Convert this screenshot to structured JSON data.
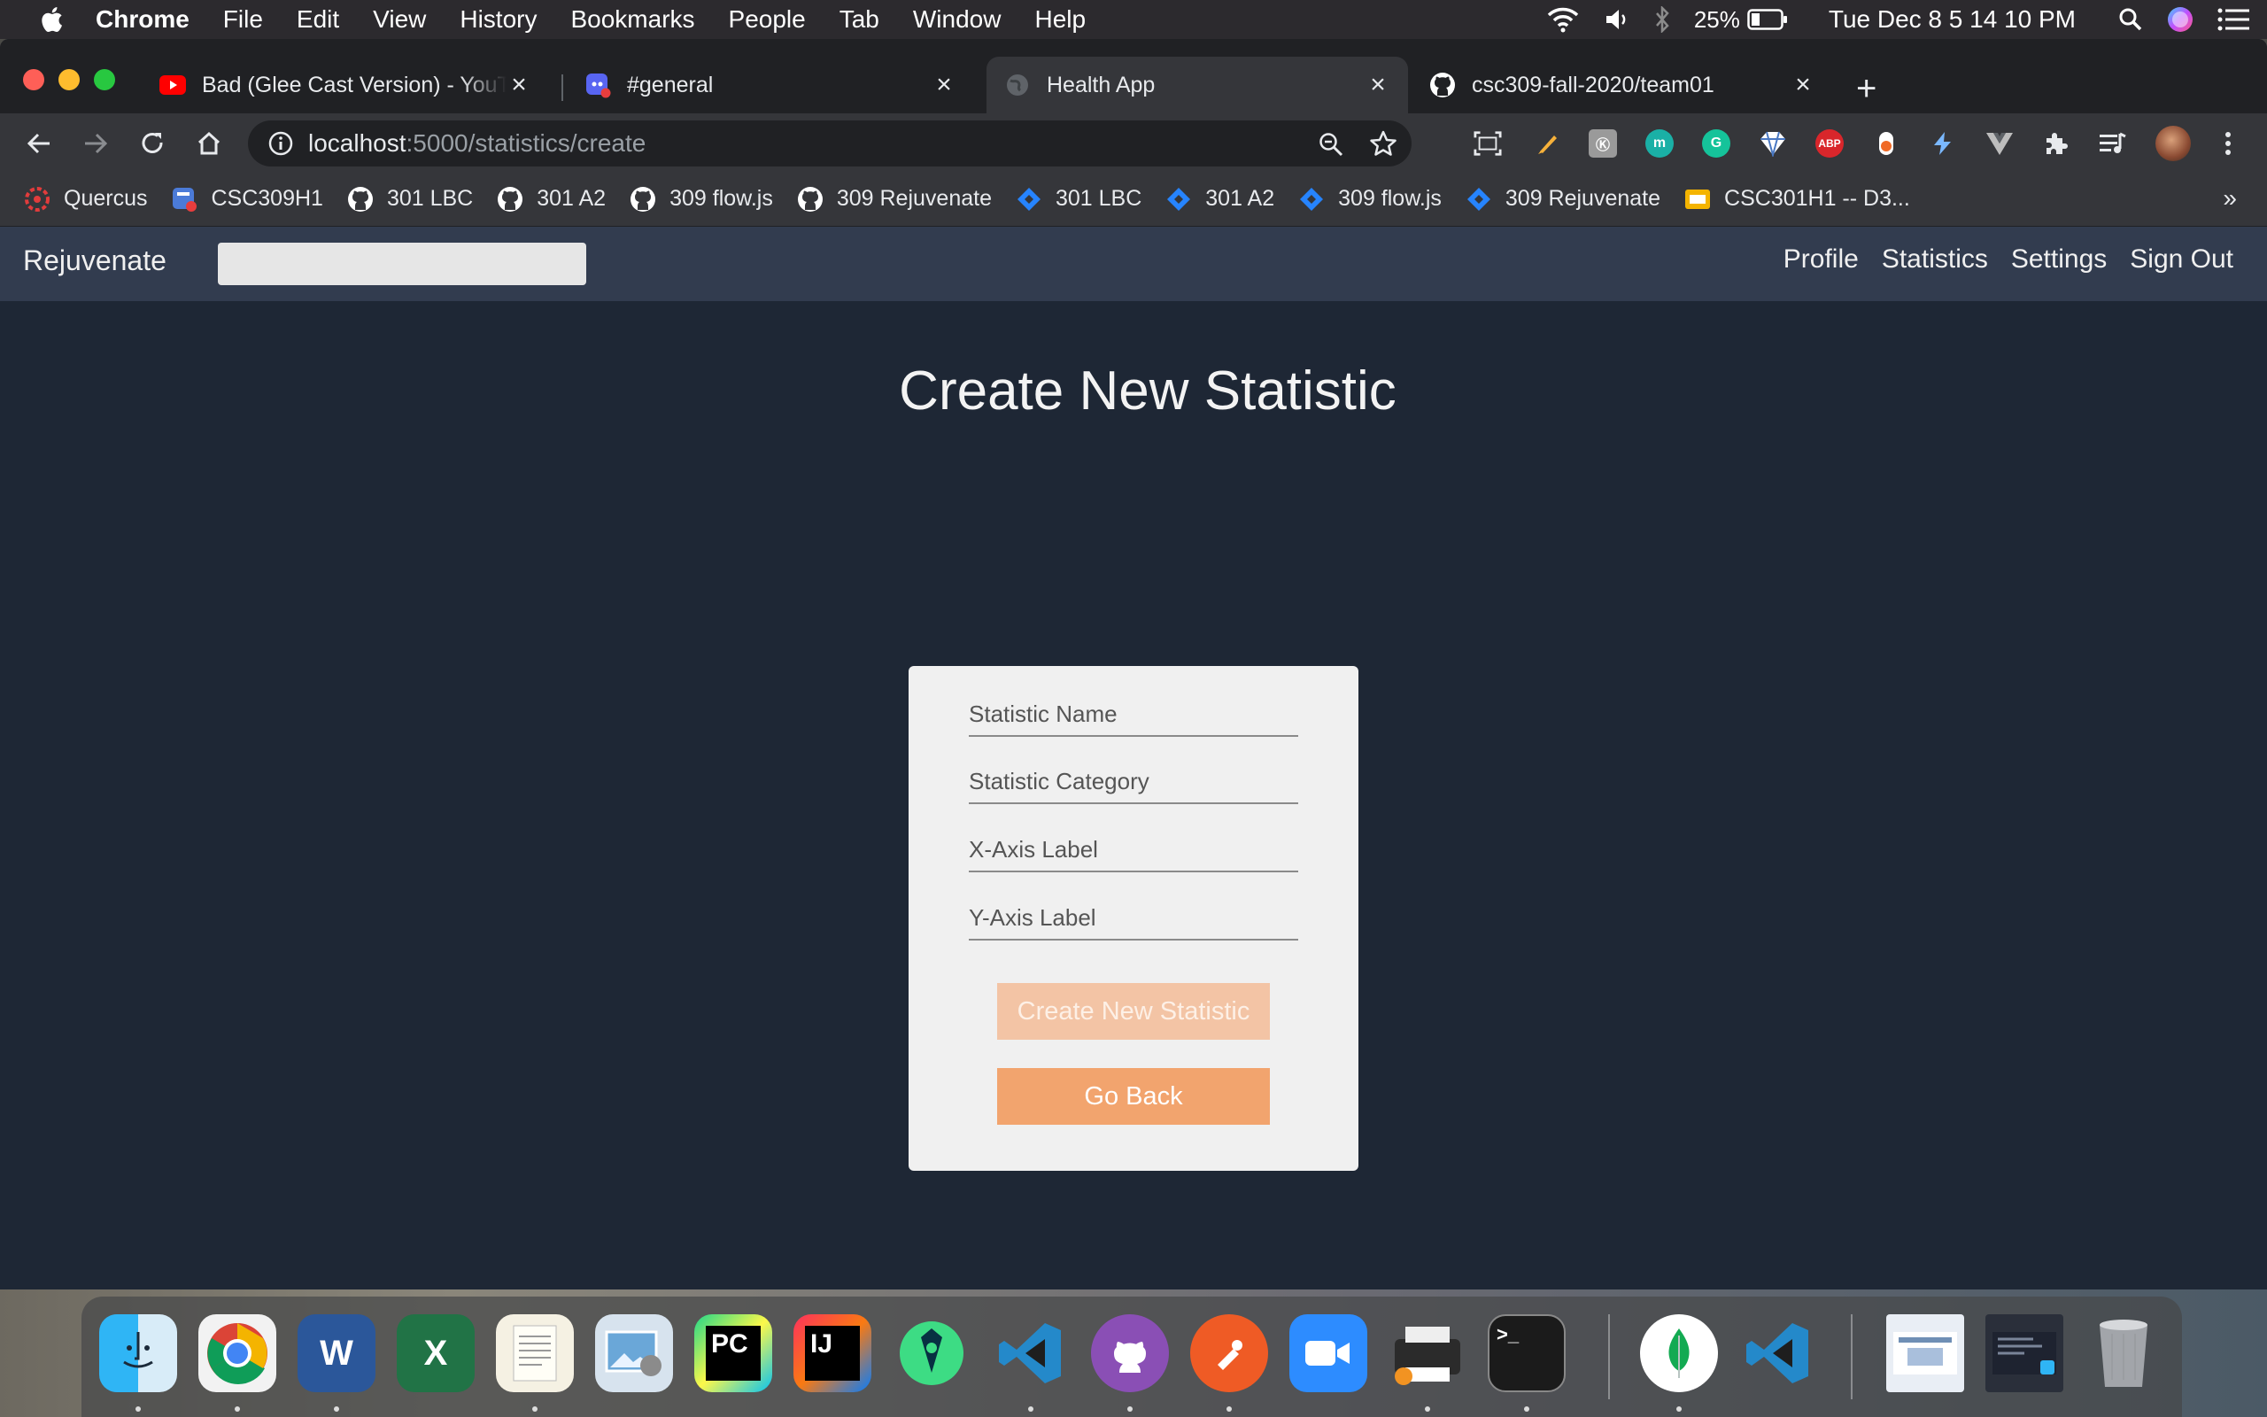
{
  "menubar": {
    "app_name": "Chrome",
    "items": [
      "File",
      "Edit",
      "View",
      "History",
      "Bookmarks",
      "People",
      "Tab",
      "Window",
      "Help"
    ],
    "battery": "25%",
    "datetime": "Tue Dec 8  5 14 10 PM"
  },
  "tabs": [
    {
      "title": "Bad (Glee Cast Version) - YouT",
      "icon": "youtube-icon"
    },
    {
      "title": "#general",
      "icon": "discord-icon"
    },
    {
      "title": "Health App",
      "icon": "globe-icon"
    },
    {
      "title": "csc309-fall-2020/team01",
      "icon": "github-icon"
    }
  ],
  "omnibox": {
    "host": "localhost",
    "path": ":5000/statistics/create"
  },
  "bookmarks": [
    {
      "label": "Quercus",
      "icon": "quercus-icon"
    },
    {
      "label": "CSC309H1",
      "icon": "piazza-icon"
    },
    {
      "label": "301 LBC",
      "icon": "github-icon"
    },
    {
      "label": "301 A2",
      "icon": "github-icon"
    },
    {
      "label": "309 flow.js",
      "icon": "github-icon"
    },
    {
      "label": "309 Rejuvenate",
      "icon": "github-icon"
    },
    {
      "label": "301 LBC",
      "icon": "jira-icon"
    },
    {
      "label": "301 A2",
      "icon": "jira-icon"
    },
    {
      "label": "309 flow.js",
      "icon": "jira-icon"
    },
    {
      "label": "309 Rejuvenate",
      "icon": "jira-icon"
    },
    {
      "label": "CSC301H1 -- D3...",
      "icon": "slides-icon"
    }
  ],
  "app": {
    "brand": "Rejuvenate",
    "nav_links": [
      "Profile",
      "Statistics",
      "Settings",
      "Sign Out"
    ],
    "heading": "Create New Statistic",
    "form": {
      "name_placeholder": "Statistic Name",
      "category_placeholder": "Statistic Category",
      "x_placeholder": "X-Axis Label",
      "y_placeholder": "Y-Axis Label",
      "create_label": "Create New Statistic",
      "back_label": "Go Back"
    }
  },
  "colors": {
    "page_bg": "#1e2735",
    "navbar_bg": "#323c4f",
    "button": "#f2a46e",
    "button_disabled": "#f3c4a5"
  }
}
